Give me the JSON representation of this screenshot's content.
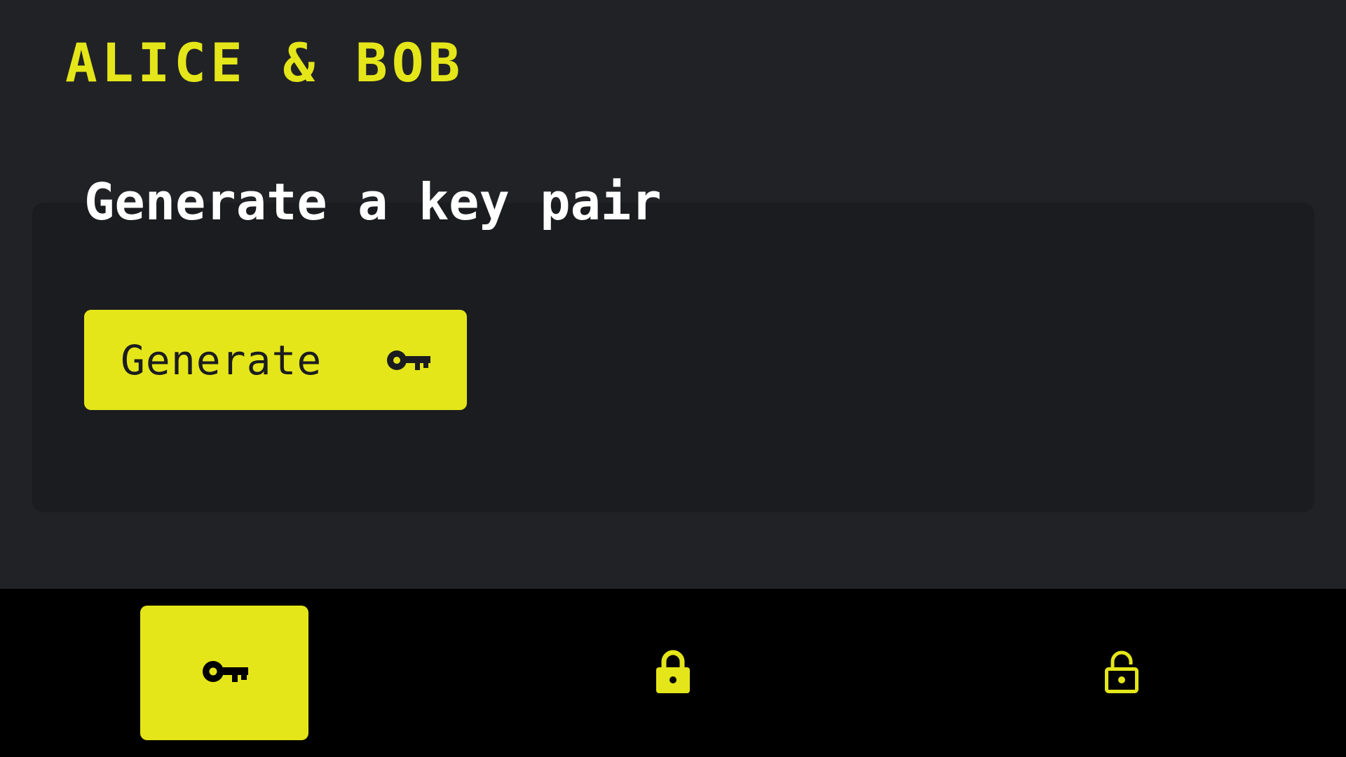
{
  "app": {
    "title": "ALICE & BOB",
    "accent_color": "#e4e619",
    "background_color": "#212226",
    "card_color": "#1b1c1f",
    "nav_background_color": "#000000"
  },
  "main": {
    "heading": "Generate a key pair",
    "generate_button": {
      "label": "Generate",
      "icon": "key-icon"
    }
  },
  "bottom_nav": {
    "items": [
      {
        "icon": "key-icon",
        "active": true
      },
      {
        "icon": "lock-icon",
        "active": false
      },
      {
        "icon": "unlock-icon",
        "active": false
      }
    ]
  }
}
